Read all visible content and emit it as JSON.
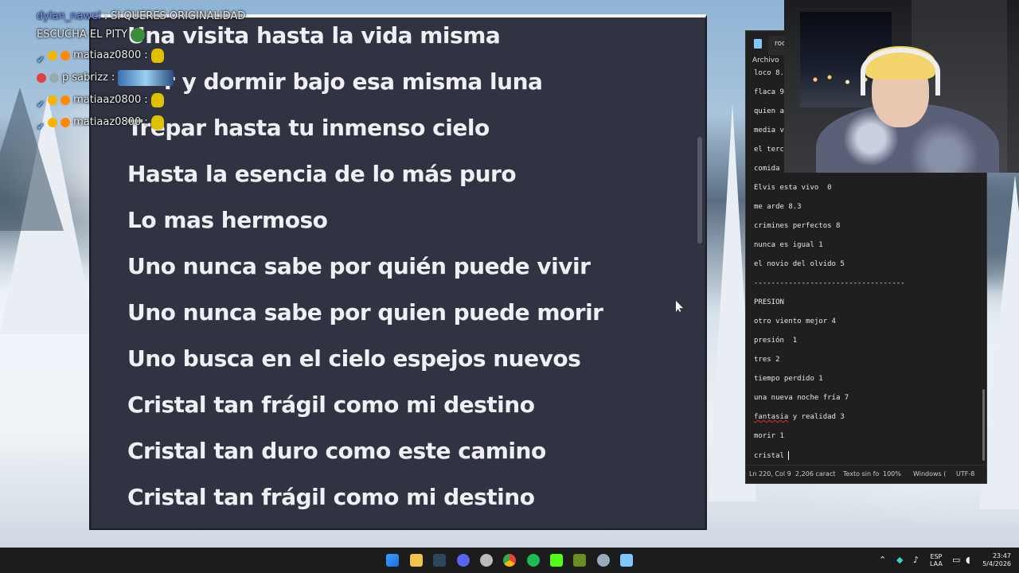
{
  "chat": {
    "messages": [
      {
        "user": "dylan_nawel",
        "text": "SI QUERES ORIGINALIDAD"
      },
      {
        "user": "",
        "text": "ESCUCHA EL PITY"
      },
      {
        "user": "matiaaz0800",
        "text": ""
      },
      {
        "user": "p",
        "user_tail": "sabrizz",
        "text": ""
      },
      {
        "user": "matiaaz0800",
        "text": ""
      },
      {
        "user": "matiaaz0800",
        "text": ""
      }
    ]
  },
  "lyrics": {
    "lines": [
      "Una visita hasta la vida misma",
      "r y dormir bajo esa misma luna",
      "Trepar hasta tu inmenso cielo",
      "Hasta la esencia de lo más puro",
      "Lo mas hermoso",
      "Uno nunca sabe por quién puede vivir",
      "Uno nunca sabe por quien puede morir",
      "Uno busca en el cielo espejos nuevos",
      "Cristal tan frágil como mi destino",
      "Cristal tan duro como este camino",
      "Cristal tan frágil como mi destino"
    ]
  },
  "notepad": {
    "tab_title": "roc",
    "menu": "Archivo",
    "lines": [
      "loco 8.",
      "flaca 9",
      "quien a",
      "media v",
      "el terc",
      "comida",
      "Elvis esta vivo  0",
      "me arde 8.3",
      "crimines perfectos 8",
      "nunca es igual 1",
      "el novio del olvido 5",
      "-----------------------------------",
      "PRESION",
      "otro viento mejor 4",
      "presión  1",
      "tres 2",
      "tiempo perdido 1",
      "una nueva noche fría 7",
      "fantasia",
      "morir 1",
      "cristal "
    ],
    "line19_rest": " y realidad 3",
    "status": {
      "position": "Ln 220, Col 9",
      "chars": "2,206 caract",
      "format": "Texto sin fo",
      "zoom": "100%",
      "eol": "Windows (",
      "encoding": "UTF-8"
    }
  },
  "taskbar": {
    "lang_top": "ESP",
    "lang_bottom": "LAA",
    "time": "23:47",
    "date": "5/4/2026"
  }
}
